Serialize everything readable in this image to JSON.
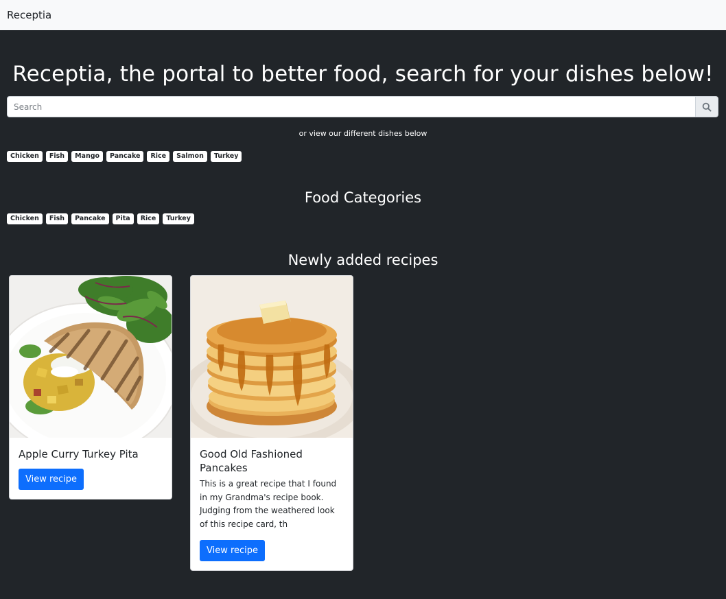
{
  "navbar": {
    "brand": "Receptia"
  },
  "hero": {
    "title": "Receptia, the portal to better food, search for your dishes below!"
  },
  "search": {
    "placeholder": "Search",
    "value": ""
  },
  "subtext": "or view our different dishes below",
  "dish_tags": [
    "Chicken",
    "Fish",
    "Mango",
    "Pancake",
    "Rice",
    "Salmon",
    "Turkey"
  ],
  "food_categories": {
    "title": "Food Categories",
    "tags": [
      "Chicken",
      "Fish",
      "Pancake",
      "Pita",
      "Rice",
      "Turkey"
    ]
  },
  "recipes": {
    "title": "Newly added recipes",
    "cards": [
      {
        "title": "Apple Curry Turkey Pita",
        "description": "",
        "button": "View recipe",
        "image_icon": "pita-sandwich-photo"
      },
      {
        "title": "Good Old Fashioned Pancakes",
        "description": "This is a great recipe that I found in my Grandma's recipe book. Judging from the weathered look of this recipe card, th",
        "button": "View recipe",
        "image_icon": "pancake-stack-photo"
      }
    ]
  },
  "colors": {
    "page_bg": "#212529",
    "navbar_bg": "#f8f9fa",
    "button": "#0d6efd"
  }
}
